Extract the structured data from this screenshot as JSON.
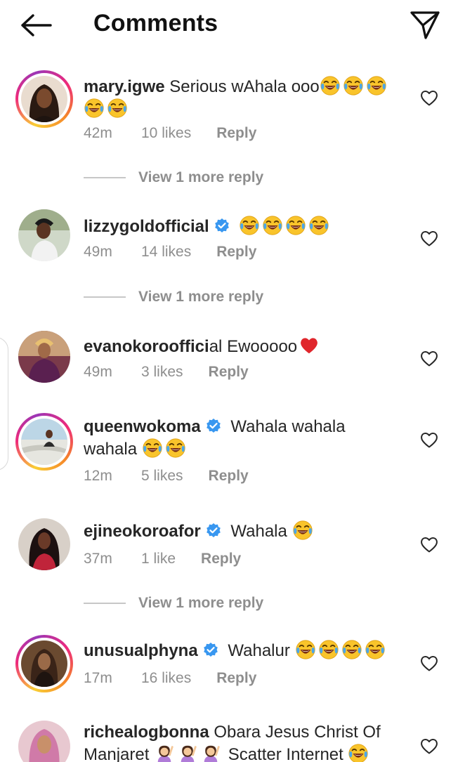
{
  "header": {
    "title": "Comments",
    "back_icon": "back-arrow-icon",
    "send_icon": "send-direct-icon"
  },
  "comments": [
    {
      "username": "mary.igwe",
      "verified": false,
      "text": "Serious wAhala ooo",
      "emoji": "face-with-tears-of-joy",
      "emoji_count": 5,
      "time": "42m",
      "likes": "10 likes",
      "reply": "Reply",
      "view_replies": "View 1 more reply"
    },
    {
      "username": "lizzygoldofficial",
      "verified": true,
      "text": "",
      "emoji": "face-with-tears-of-joy",
      "emoji_count": 4,
      "time": "49m",
      "likes": "14 likes",
      "reply": "Reply",
      "view_replies": "View 1 more reply"
    },
    {
      "username": "evanokorooffici",
      "username_tail": "al",
      "verified": false,
      "text": "Ewooooo",
      "emoji": "red-heart",
      "emoji_count": 1,
      "time": "49m",
      "likes": "3 likes",
      "reply": "Reply"
    },
    {
      "username": "queenwokoma",
      "verified": true,
      "text": "Wahala wahala wahala",
      "emoji": "face-with-tears-of-joy",
      "emoji_count": 2,
      "time": "12m",
      "likes": "5 likes",
      "reply": "Reply"
    },
    {
      "username": "ejineokoroafor",
      "verified": true,
      "text": "Wahala",
      "emoji": "face-with-tears-of-joy",
      "emoji_count": 1,
      "time": "37m",
      "likes": "1 like",
      "reply": "Reply",
      "view_replies": "View 1 more reply"
    },
    {
      "username": "unusualphyna",
      "verified": true,
      "text": "Wahalur",
      "emoji": "face-with-tears-of-joy",
      "emoji_count": 4,
      "time": "17m",
      "likes": "16 likes",
      "reply": "Reply"
    },
    {
      "username": "richealogbonna",
      "verified": false,
      "text": "Obara Jesus Christ Of Manjaret",
      "text_tail": "Scatter Internet",
      "emoji": "woman-raising-hand",
      "emoji_count": 3
    }
  ],
  "colors": {
    "verified_blue": "#3897f0",
    "meta_gray": "#8e8e8e",
    "text": "#262626",
    "emoji_yellow": "#f9c42b",
    "heart_red": "#e0262c"
  }
}
